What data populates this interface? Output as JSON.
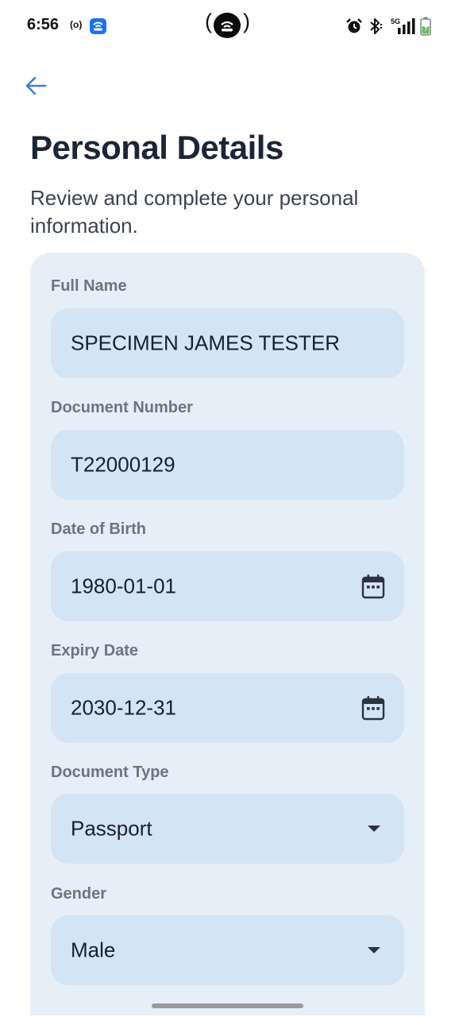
{
  "status_bar": {
    "time": "6:56",
    "radio_indicator": "(o)",
    "network": "5G",
    "icons": [
      "app-notification-icon",
      "camera-cutout",
      "alarm-icon",
      "bluetooth-icon",
      "signal-icon",
      "battery-icon"
    ]
  },
  "header": {
    "back_icon": "arrow-left-icon",
    "title": "Personal Details",
    "subtitle": "Review and complete your personal information."
  },
  "form": {
    "fields": [
      {
        "label": "Full Name",
        "value": "SPECIMEN JAMES TESTER"
      },
      {
        "label": "Document Number",
        "value": "T22000129"
      },
      {
        "label": "Date of Birth",
        "value": "1980-01-01",
        "icon": "calendar-icon"
      },
      {
        "label": "Expiry Date",
        "value": "2030-12-31",
        "icon": "calendar-icon"
      },
      {
        "label": "Document Type",
        "value": "Passport",
        "icon": "dropdown-caret-icon"
      },
      {
        "label": "Gender",
        "value": "Male",
        "icon": "dropdown-caret-icon"
      }
    ]
  },
  "colors": {
    "accent": "#3d7fd1",
    "title": "#1b2536",
    "card_bg": "#e6eef7",
    "field_bg": "#d3e4f5",
    "label": "#6b7480"
  }
}
